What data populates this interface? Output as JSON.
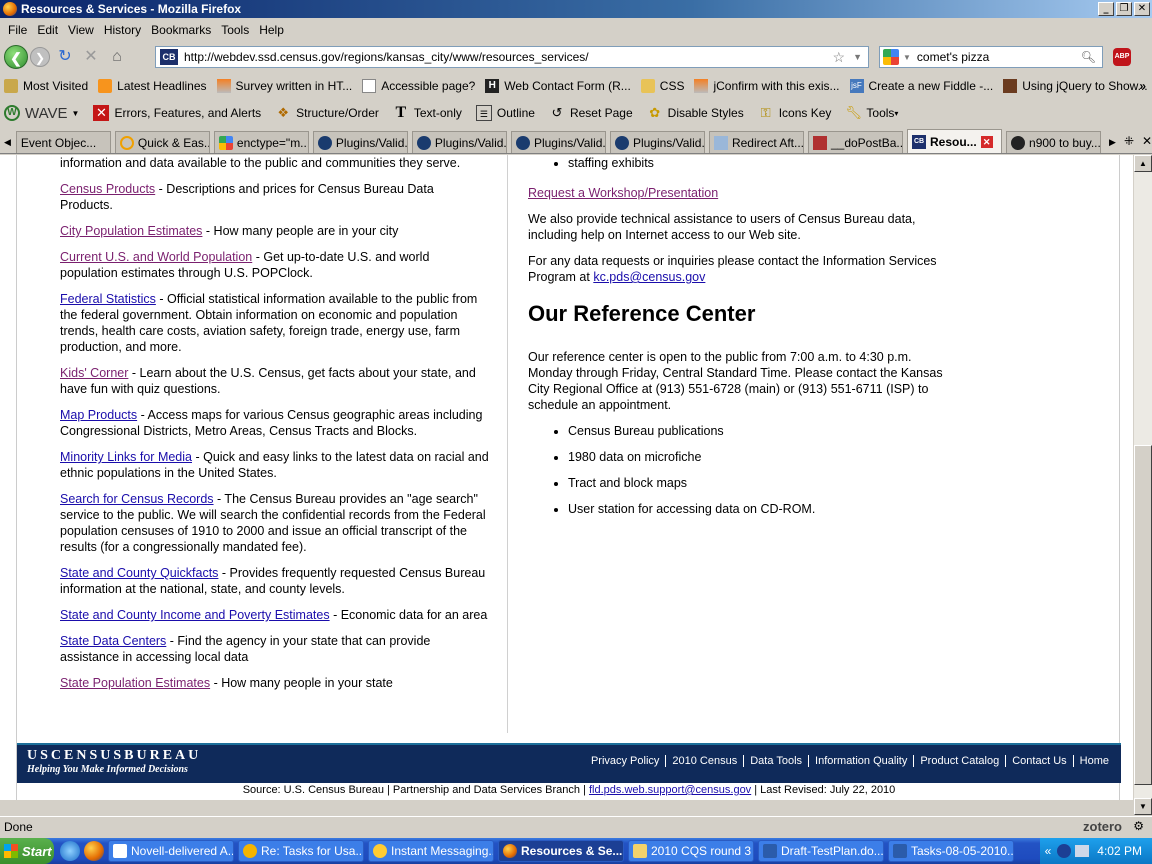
{
  "window": {
    "title": "Resources & Services - Mozilla Firefox"
  },
  "menu": [
    "File",
    "Edit",
    "View",
    "History",
    "Bookmarks",
    "Tools",
    "Help"
  ],
  "nav": {
    "url": "http://webdev.ssd.census.gov/regions/kansas_city/www/resources_services/",
    "search": "comet's pizza",
    "abp": "ABP"
  },
  "bookmarks": [
    "Most Visited",
    "Latest Headlines",
    "Survey written in HT...",
    "Accessible page?",
    "Web Contact Form (R...",
    "CSS",
    "jConfirm with this exis...",
    "Create a new Fiddle -...",
    "Using jQuery to Show..."
  ],
  "wave": {
    "brand": "WAVE",
    "items": [
      "Errors, Features, and Alerts",
      "Structure/Order",
      "Text-only",
      "Outline",
      "Reset Page",
      "Disable Styles",
      "Icons Key",
      "Tools"
    ]
  },
  "tabs": [
    "Event Objec...",
    "Quick & Eas...",
    "enctype=\"m...",
    "Plugins/Valid...",
    "Plugins/Valid...",
    "Plugins/Valid...",
    "Plugins/Valid...",
    "Redirect Aft...",
    "__doPostBa...",
    "Resou...",
    "n900 to buy..."
  ],
  "left": {
    "intro": "information and data available to the public and communities they serve.",
    "entries": [
      {
        "link": "Census Products",
        "desc": " - Descriptions and prices for Census Bureau Data Products."
      },
      {
        "link": "City Population Estimates",
        "desc": " - How many people are in your city"
      },
      {
        "link": "Current U.S. and World Population",
        "desc": " - Get up-to-date U.S. and world population estimates through U.S. POPClock."
      },
      {
        "link": "Federal Statistics",
        "desc": " - Official statistical information available to the public from the federal government. Obtain information on economic and population trends, health care costs, aviation safety, foreign trade, energy use, farm production, and more."
      },
      {
        "link": "Kids' Corner",
        "desc": " - Learn about the U.S. Census, get facts about your state, and have fun with quiz questions."
      },
      {
        "link": "Map Products",
        "desc": " - Access maps for various Census geographic areas including Congressional Districts, Metro Areas, Census Tracts and Blocks."
      },
      {
        "link": "Minority Links for Media",
        "desc": " - Quick and easy links to the latest data on racial and ethnic populations in the United States."
      },
      {
        "link": "Search for Census Records",
        "desc": " - The Census Bureau provides an \"age search\" service to the public. We will search the confidential records from the Federal population censuses of 1910 to 2000 and issue an official transcript of the results (for a congressionally mandated fee)."
      },
      {
        "link": "State and County Quickfacts",
        "desc": " - Provides frequently requested Census Bureau information at the national, state, and county levels."
      },
      {
        "link": "State and County Income and Poverty Estimates",
        "desc": " - Economic data for an area"
      },
      {
        "link": "State Data Centers",
        "desc": " - Find the agency in your state that can provide assistance in accessing local data"
      },
      {
        "link": "State Population Estimates",
        "desc": " - How many people in your state"
      }
    ]
  },
  "right": {
    "bullet_top": "staffing exhibits",
    "workshop_link": "Request a Workshop/Presentation",
    "assist": "We also provide technical assistance to users of Census Bureau data, including help on Internet access to our Web site.",
    "contact_pre": "For any data requests or inquiries please contact the Information Services Program at ",
    "contact_email": "kc.pds@census.gov",
    "ref_heading": "Our Reference Center",
    "ref_text": "Our reference center is open to the public from 7:00 a.m. to 4:30 p.m. Monday through Friday, Central Standard Time. Please contact the Kansas City Regional Office at (913) 551-6728 (main) or (913) 551-6711 (ISP) to schedule an appointment.",
    "ref_items": [
      "Census Bureau publications",
      "1980 data on microfiche",
      "Tract and block maps",
      "User station for accessing data on CD-ROM."
    ]
  },
  "footer": {
    "logo": "USCENSUSBUREAU",
    "tagline": "Helping You Make Informed Decisions",
    "links": [
      "Privacy Policy",
      "2010 Census",
      "Data Tools",
      "Information Quality",
      "Product Catalog",
      "Contact Us",
      "Home"
    ],
    "source_pre": "Source: U.S. Census Bureau | Partnership and Data Services Branch | ",
    "source_email": "fld.pds.web.support@census.gov",
    "source_post": " | Last Revised: July 22, 2010"
  },
  "status": {
    "text": "Done",
    "zotero": "zotero"
  },
  "taskbar": {
    "start": "Start",
    "items": [
      "Novell-delivered A...",
      "Re: Tasks for Usa...",
      "Instant Messaging...",
      "Resources & Se...",
      "2010 CQS round 3",
      "Draft-TestPlan.do...",
      "Tasks-08-05-2010...."
    ],
    "clock": "4:02 PM"
  }
}
